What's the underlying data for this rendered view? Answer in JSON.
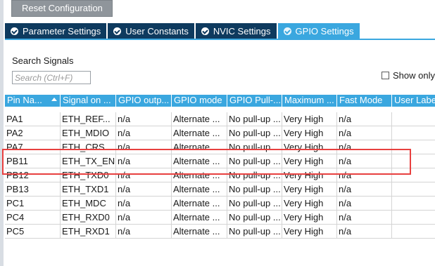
{
  "toolbar": {
    "reset_label": "Reset Configuration"
  },
  "tabs": [
    {
      "label": "Parameter Settings",
      "active": false
    },
    {
      "label": "User Constants",
      "active": false
    },
    {
      "label": "NVIC Settings",
      "active": false
    },
    {
      "label": "GPIO Settings",
      "active": true
    }
  ],
  "search": {
    "label": "Search Signals",
    "placeholder": "Search (Ctrl+F)",
    "show_only_label": "Show only"
  },
  "table": {
    "columns": [
      "Pin Na...",
      "Signal on ...",
      "GPIO outp...",
      "GPIO mode",
      "GPIO Pull-...",
      "Maximum ...",
      "Fast Mode",
      "User Labe"
    ],
    "rows": [
      [
        "PA1",
        "ETH_REF...",
        "n/a",
        "Alternate ...",
        "No pull-up ...",
        "Very High",
        "n/a",
        ""
      ],
      [
        "PA2",
        "ETH_MDIO",
        "n/a",
        "Alternate ...",
        "No pull-up ...",
        "Very High",
        "n/a",
        ""
      ],
      [
        "PA7",
        "ETH_CRS...",
        "n/a",
        "Alternate ...",
        "No pull-up ...",
        "Very High",
        "n/a",
        ""
      ],
      [
        "PB11",
        "ETH_TX_EN",
        "n/a",
        "Alternate ...",
        "No pull-up ...",
        "Very High",
        "n/a",
        ""
      ],
      [
        "PB12",
        "ETH_TXD0",
        "n/a",
        "Alternate ...",
        "No pull-up ...",
        "Very High",
        "n/a",
        ""
      ],
      [
        "PB13",
        "ETH_TXD1",
        "n/a",
        "Alternate ...",
        "No pull-up ...",
        "Very High",
        "n/a",
        ""
      ],
      [
        "PC1",
        "ETH_MDC",
        "n/a",
        "Alternate ...",
        "No pull-up ...",
        "Very High",
        "n/a",
        ""
      ],
      [
        "PC4",
        "ETH_RXD0",
        "n/a",
        "Alternate ...",
        "No pull-up ...",
        "Very High",
        "n/a",
        ""
      ],
      [
        "PC5",
        "ETH_RXD1",
        "n/a",
        "Alternate ...",
        "No pull-up ...",
        "Very High",
        "n/a",
        ""
      ]
    ]
  },
  "colors": {
    "tab_active": "#3aa7df",
    "tab_inactive": "#0e3a5e",
    "header_bg": "#3aa7df",
    "highlight": "#e8403f"
  }
}
